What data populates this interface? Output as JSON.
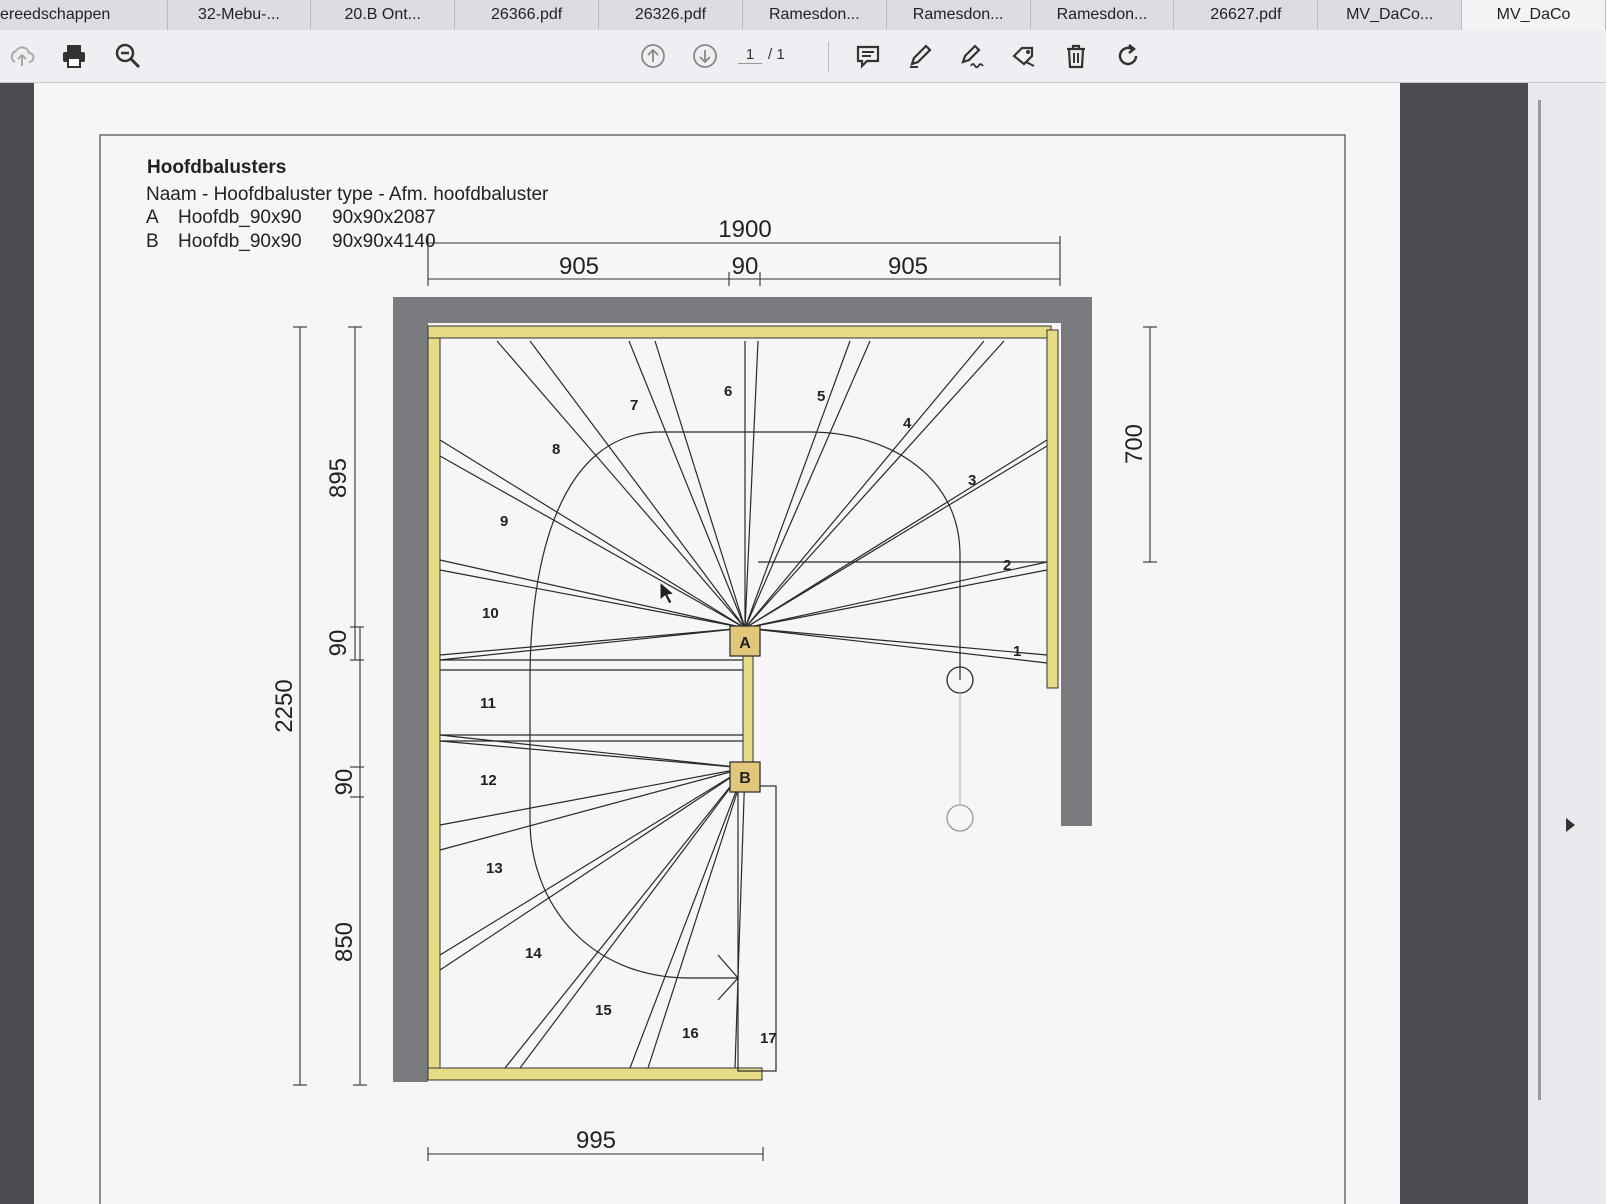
{
  "tabs": [
    {
      "label": "ereedschappen"
    },
    {
      "label": "32-Mebu-..."
    },
    {
      "label": "20.B Ont..."
    },
    {
      "label": "26366.pdf"
    },
    {
      "label": "26326.pdf"
    },
    {
      "label": "Ramesdon..."
    },
    {
      "label": "Ramesdon..."
    },
    {
      "label": "Ramesdon..."
    },
    {
      "label": "26627.pdf"
    },
    {
      "label": "MV_DaCo..."
    },
    {
      "label": "MV_DaCo"
    }
  ],
  "toolbar": {
    "icons": [
      "upload-cloud-icon",
      "print-icon",
      "zoom-out-icon",
      "page-up-icon",
      "page-down-icon",
      "comment-icon",
      "pen-icon",
      "sign-icon",
      "stamp-icon",
      "trash-icon",
      "rotate-icon"
    ],
    "page_current": "1",
    "page_total": "/ 1"
  },
  "legend": {
    "title": "Hoofdbalusters",
    "header": "Naam - Hoofdbaluster type - Afm. hoofdbaluster",
    "rows": [
      {
        "id": "A",
        "type": "Hoofdb_90x90",
        "size": "90x90x2087"
      },
      {
        "id": "B",
        "type": "Hoofdb_90x90",
        "size": "90x90x4140"
      }
    ]
  },
  "dimensions": {
    "total_width": "1900",
    "left_width": "905",
    "post_width": "90",
    "right_width": "905",
    "total_depth": "2250",
    "upper_depth": "895",
    "post_a": "90",
    "post_b": "90",
    "lower_depth": "850",
    "right_depth": "700",
    "bottom_width": "995"
  },
  "posts": [
    "A",
    "B"
  ],
  "steps": [
    "1",
    "2",
    "3",
    "4",
    "5",
    "6",
    "7",
    "8",
    "9",
    "10",
    "11",
    "12",
    "13",
    "14",
    "15",
    "16",
    "17"
  ],
  "colors": {
    "wall": "#7a7b7f",
    "stringer": "#e6dc86",
    "post": "#e2c67a",
    "line": "#2a2a2a"
  }
}
